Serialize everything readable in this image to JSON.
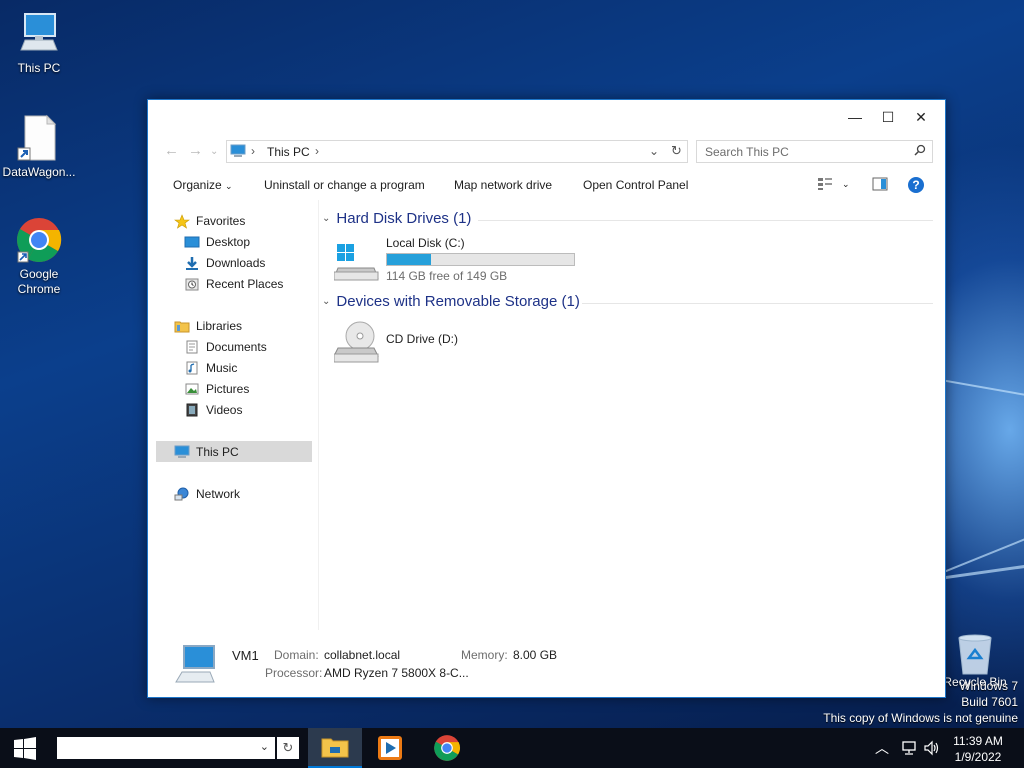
{
  "desktop": {
    "icons": [
      {
        "label": "This PC"
      },
      {
        "label": "DataWagon..."
      },
      {
        "label": "Google Chrome"
      },
      {
        "label": "Recycle Bin"
      }
    ],
    "watermark": [
      "Windows 7",
      "Build 7601",
      "This copy of Windows is not genuine"
    ]
  },
  "window": {
    "controls": {
      "minimize": "—",
      "maximize": "☐",
      "close": "✕"
    },
    "address": {
      "path": "This PC"
    },
    "search": {
      "placeholder": "Search This PC"
    },
    "toolbar": {
      "organize": "Organize",
      "uninstall": "Uninstall or change a program",
      "map_drive": "Map network drive",
      "control_panel": "Open Control Panel"
    },
    "nav": {
      "favorites": "Favorites",
      "desktop": "Desktop",
      "downloads": "Downloads",
      "recent": "Recent Places",
      "libraries": "Libraries",
      "documents": "Documents",
      "music": "Music",
      "pictures": "Pictures",
      "videos": "Videos",
      "this_pc": "This PC",
      "network": "Network"
    },
    "groups": {
      "hdd": {
        "title": "Hard Disk Drives (1)"
      },
      "removable": {
        "title": "Devices with Removable Storage (1)"
      }
    },
    "drives": {
      "c": {
        "name": "Local Disk (C:)",
        "space": "114 GB free of 149 GB",
        "used_fraction": 0.235
      },
      "d": {
        "name": "CD Drive (D:)"
      }
    },
    "details": {
      "computer_name": "VM1",
      "domain_label": "Domain:",
      "domain": "collabnet.local",
      "memory_label": "Memory:",
      "memory": "8.00 GB",
      "processor_label": "Processor:",
      "processor": "AMD Ryzen 7 5800X 8-C..."
    }
  },
  "taskbar": {
    "time": "11:39 AM",
    "date": "1/9/2022",
    "accent": "#0078d7"
  }
}
